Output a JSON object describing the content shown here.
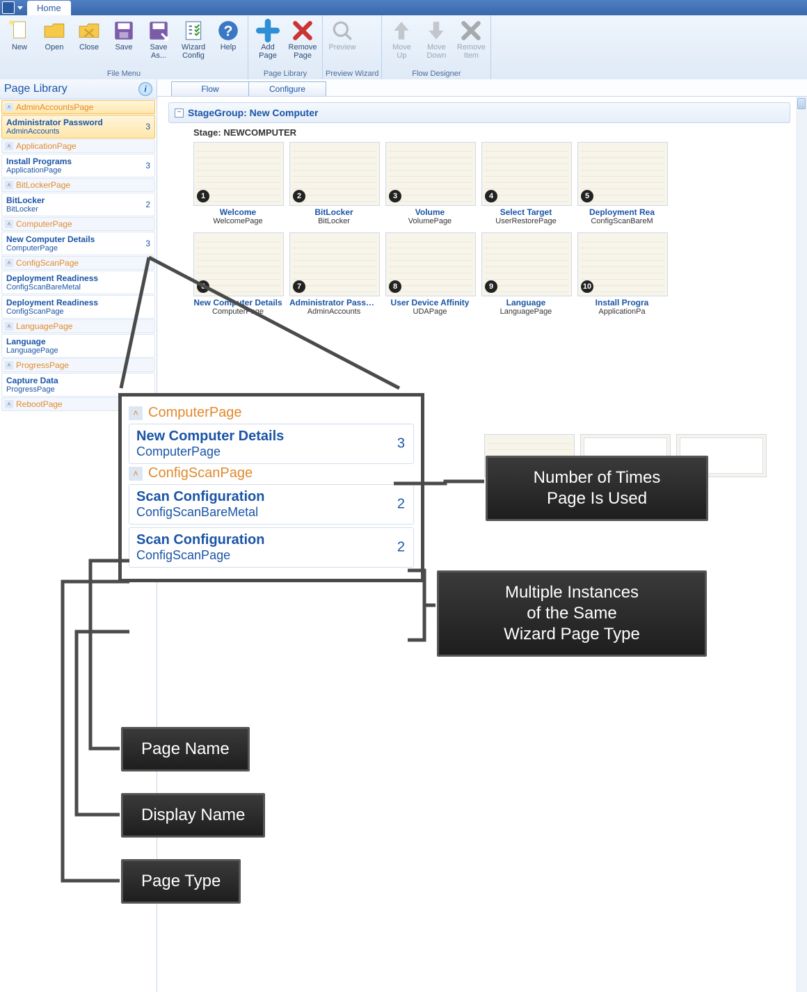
{
  "titlebar": {
    "tab": "Home"
  },
  "ribbon": {
    "groups": [
      {
        "name": "File Menu",
        "buttons": [
          {
            "id": "new",
            "label": "New"
          },
          {
            "id": "open",
            "label": "Open"
          },
          {
            "id": "close",
            "label": "Close"
          },
          {
            "id": "save",
            "label": "Save"
          },
          {
            "id": "saveas",
            "label": "Save\nAs..."
          },
          {
            "id": "wizcfg",
            "label": "Wizard\nConfig"
          },
          {
            "id": "help",
            "label": "Help"
          }
        ]
      },
      {
        "name": "Page Library",
        "buttons": [
          {
            "id": "addpage",
            "label": "Add\nPage"
          },
          {
            "id": "removepage",
            "label": "Remove\nPage"
          }
        ]
      },
      {
        "name": "Preview Wizard",
        "disabled": true,
        "buttons": [
          {
            "id": "preview",
            "label": "Preview"
          }
        ]
      },
      {
        "name": "Flow Designer",
        "disabled": true,
        "buttons": [
          {
            "id": "moveup",
            "label": "Move\nUp"
          },
          {
            "id": "movedown",
            "label": "Move\nDown"
          },
          {
            "id": "removeitem",
            "label": "Remove\nItem"
          }
        ]
      }
    ]
  },
  "sidebar": {
    "title": "Page Library",
    "groups": [
      {
        "cat": "AdminAccountsPage",
        "selected": true,
        "items": [
          {
            "name": "Administrator Password",
            "type": "AdminAccounts",
            "count": 3,
            "selected": true
          }
        ]
      },
      {
        "cat": "ApplicationPage",
        "items": [
          {
            "name": "Install Programs",
            "type": "ApplicationPage",
            "count": 3
          }
        ]
      },
      {
        "cat": "BitLockerPage",
        "items": [
          {
            "name": "BitLocker",
            "type": "BitLocker",
            "count": 2
          }
        ]
      },
      {
        "cat": "ComputerPage",
        "items": [
          {
            "name": "New Computer Details",
            "type": "ComputerPage",
            "count": 3
          }
        ]
      },
      {
        "cat": "ConfigScanPage",
        "items": [
          {
            "name": "Deployment Readiness",
            "type": "ConfigScanBareMetal",
            "count": ""
          },
          {
            "name": "Deployment Readiness",
            "type": "ConfigScanPage",
            "count": ""
          }
        ]
      },
      {
        "cat": "LanguagePage",
        "items": [
          {
            "name": "Language",
            "type": "LanguagePage",
            "count": ""
          }
        ]
      },
      {
        "cat": "ProgressPage",
        "items": [
          {
            "name": "Capture Data",
            "type": "ProgressPage",
            "count": ""
          }
        ]
      },
      {
        "cat": "RebootPage",
        "items": []
      }
    ]
  },
  "main": {
    "subtabs": [
      "Flow",
      "Configure"
    ],
    "stagegroup_title": "StageGroup: New Computer",
    "stage_label": "Stage: NEWCOMPUTER",
    "rows": [
      [
        {
          "n": 1,
          "title": "Welcome",
          "sub": "WelcomePage"
        },
        {
          "n": 2,
          "title": "BitLocker",
          "sub": "BitLocker"
        },
        {
          "n": 3,
          "title": "Volume",
          "sub": "VolumePage"
        },
        {
          "n": 4,
          "title": "Select Target",
          "sub": "UserRestorePage"
        },
        {
          "n": 5,
          "title": "Deployment Rea",
          "sub": "ConfigScanBareM",
          "cut": true
        }
      ],
      [
        {
          "n": 6,
          "title": "New Computer Details",
          "sub": "ComputerPage"
        },
        {
          "n": 7,
          "title": "Administrator Passw...",
          "sub": "AdminAccounts"
        },
        {
          "n": 8,
          "title": "User Device Affinity",
          "sub": "UDAPage"
        },
        {
          "n": 9,
          "title": "Language",
          "sub": "LanguagePage"
        },
        {
          "n": 10,
          "title": "Install Progra",
          "sub": "ApplicationPa",
          "cut": true
        }
      ]
    ]
  },
  "zoom": {
    "groups": [
      {
        "cat": "ComputerPage",
        "items": [
          {
            "name": "New Computer Details",
            "type": "ComputerPage",
            "count": 3
          }
        ]
      },
      {
        "cat": "ConfigScanPage",
        "items": [
          {
            "name": "Scan Configuration",
            "type": "ConfigScanBareMetal",
            "count": 2
          },
          {
            "name": "Scan Configuration",
            "type": "ConfigScanPage",
            "count": 2
          }
        ]
      }
    ]
  },
  "callouts": {
    "times_used": "Number of Times\nPage Is Used",
    "multi": "Multiple Instances\nof the Same\nWizard Page Type",
    "page_name": "Page Name",
    "display_name": "Display Name",
    "page_type": "Page Type"
  }
}
